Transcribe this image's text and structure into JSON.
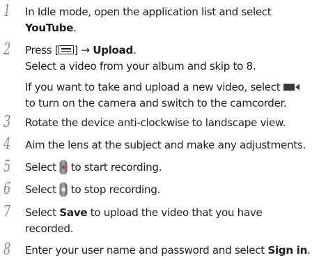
{
  "steps": [
    {
      "num": "1",
      "lines": [
        "In Idle mode, open the application list and select",
        "YouTube",
        "."
      ]
    },
    {
      "num": "2",
      "pre": "Press [",
      "post": "] → ",
      "bold": "Upload",
      "end": ".",
      "line2": "Select a video from your album and skip to 8.",
      "line3a": "If you want to take and upload a new video, select",
      "line3b": "to turn on the camera and switch to the camcorder."
    },
    {
      "num": "3",
      "text": "Rotate the device anti-clockwise to landscape view."
    },
    {
      "num": "4",
      "text": "Aim the lens at the subject and make any adjustments."
    },
    {
      "num": "5",
      "pre": "Select",
      "post": "to start recording."
    },
    {
      "num": "6",
      "pre": "Select",
      "post": "to stop recording."
    },
    {
      "num": "7",
      "pre": "Select ",
      "bold": "Save",
      "post": " to upload the video that you have",
      "line2": "recorded."
    },
    {
      "num": "8",
      "pre": "Enter your user name and password and select ",
      "bold": "Sign in",
      "end": "."
    }
  ],
  "icons": {
    "menu_key": "menu-key-icon",
    "camcorder": "camcorder-icon",
    "record": "record-button-icon",
    "stop": "stop-button-icon"
  }
}
